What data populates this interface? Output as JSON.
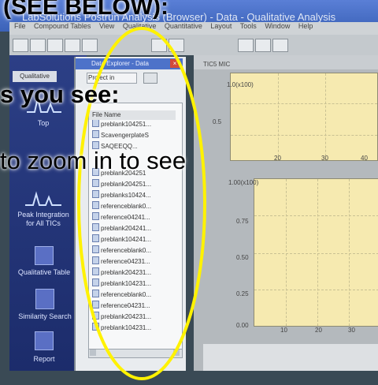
{
  "window": {
    "title": "LabSolutions Postrun Analysis (Browser) - Data - Qualitative Analysis",
    "menu": [
      "File",
      "Compound Tables",
      "View",
      "Qualitative",
      "Quantitative",
      "Layout",
      "Tools",
      "Window",
      "Help"
    ]
  },
  "overlay": {
    "line1": "(SEE BELOW):",
    "line2": "s you see:",
    "line3": "to zoom in to see"
  },
  "left_pane": {
    "header": "Qualitative",
    "items": [
      {
        "label": "Top",
        "icon": "peak-top-icon"
      },
      {
        "label": "Peak Integration for All TICs",
        "icon": "integration-icon"
      },
      {
        "label": "Qualitative Table",
        "icon": "table-icon"
      },
      {
        "label": "Similarity Search",
        "icon": "search-icon"
      },
      {
        "label": "Report",
        "icon": "report-icon"
      }
    ]
  },
  "explorer": {
    "title": "Data Explorer - Data",
    "project_label": "Project in",
    "column_header": "File Name",
    "files": [
      "preblank104251...",
      "ScavengerplateS",
      "SAQEEQQ...",
      "preblank204251",
      "preblank204251...",
      "preblanks10424...",
      "referenceblank0...",
      "reference04241...",
      "preblank204241...",
      "preblank104241...",
      "referenceblank0...",
      "reference04231...",
      "preblank204231...",
      "preblank104231...",
      "referenceblank0...",
      "reference04231...",
      "preblank204231...",
      "preblank104231..."
    ]
  },
  "charts": {
    "tic_title": "TIC5 MIC",
    "upper": {
      "y_label": "1.0(x100)",
      "y_ticks": [
        "0.5"
      ],
      "x_ticks": [
        "20",
        "30",
        "40"
      ]
    },
    "lower": {
      "y_label": "1.00(x100)",
      "y_ticks": [
        "0.75",
        "0.50",
        "0.25",
        "0.00"
      ],
      "x_ticks": [
        "10",
        "20",
        "30"
      ]
    }
  },
  "colors": {
    "plot_background": "#f6eab0",
    "highlight": "#fff200",
    "side_pane": "#2c3f86"
  }
}
